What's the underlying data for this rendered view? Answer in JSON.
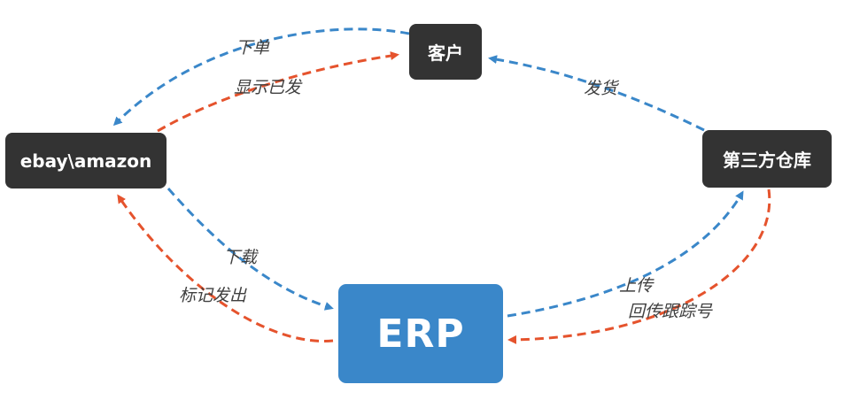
{
  "nodes": {
    "customer": "客户",
    "ebay_amazon": "ebay\\amazon",
    "warehouse": "第三方仓库",
    "erp": "ERP"
  },
  "edges": {
    "order": "下单",
    "shown_shipped": "显示已发",
    "ship": "发货",
    "download": "下载",
    "mark_shipped": "标记发出",
    "upload": "上传",
    "return_tracking": "回传跟踪号"
  },
  "colors": {
    "node_dark": "#333333",
    "node_erp": "#3a87c9",
    "arrow_blue": "#3a87c9",
    "arrow_red": "#e5532d",
    "label_text": "#404040"
  }
}
